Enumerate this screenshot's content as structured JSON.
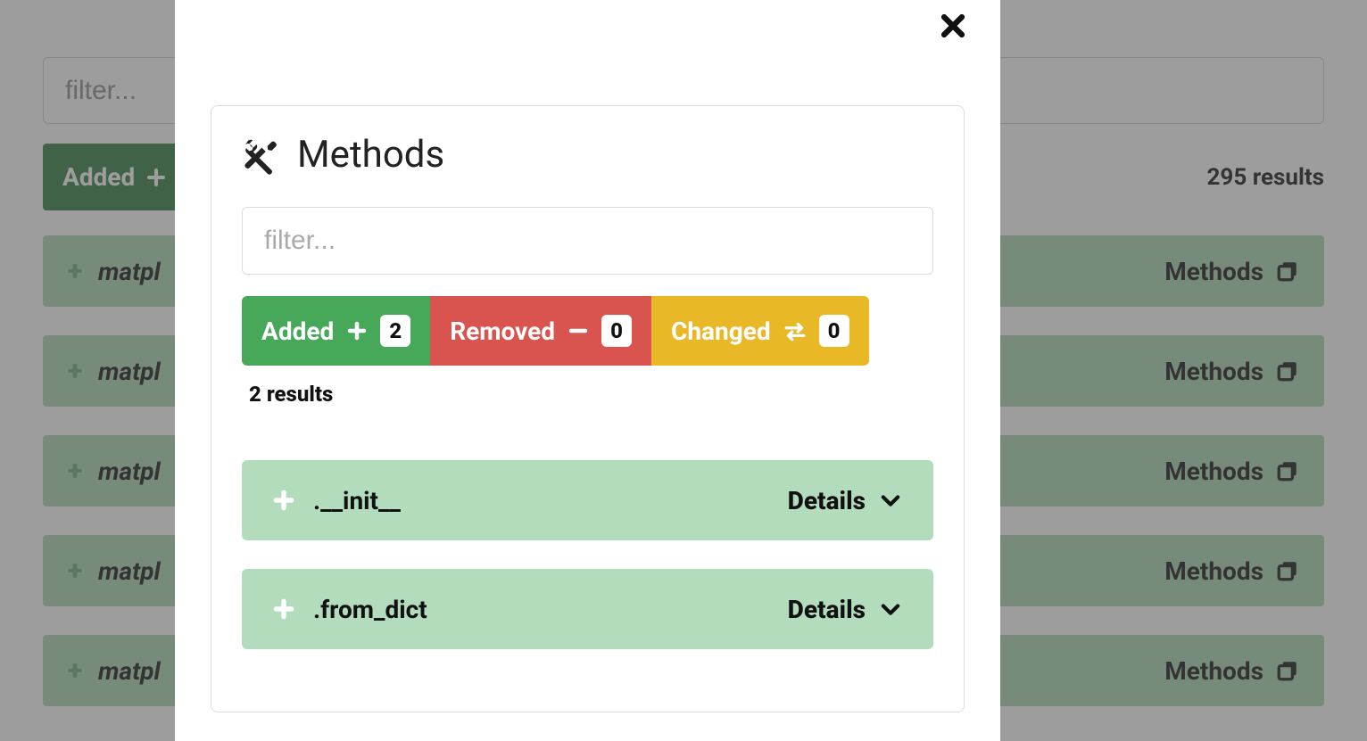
{
  "colors": {
    "added": "#47a85a",
    "added_dark": "#2d7a3d",
    "removed": "#d9534f",
    "changed": "#e8b827",
    "row_bg": "#a9d5b2",
    "modal_row_bg": "#b3dcbc"
  },
  "background": {
    "filter_placeholder": "filter...",
    "added_label": "Added",
    "results_text": "295 results",
    "row_name_prefix": "matpl",
    "methods_label": "Methods"
  },
  "modal": {
    "title": "Methods",
    "filter_placeholder": "filter...",
    "pills": {
      "added": {
        "label": "Added",
        "count": "2"
      },
      "removed": {
        "label": "Removed",
        "count": "0"
      },
      "changed": {
        "label": "Changed",
        "count": "0"
      }
    },
    "results_text": "2 results",
    "details_label": "Details",
    "rows": [
      {
        "name": ".__init__"
      },
      {
        "name": ".from_dict"
      }
    ]
  }
}
